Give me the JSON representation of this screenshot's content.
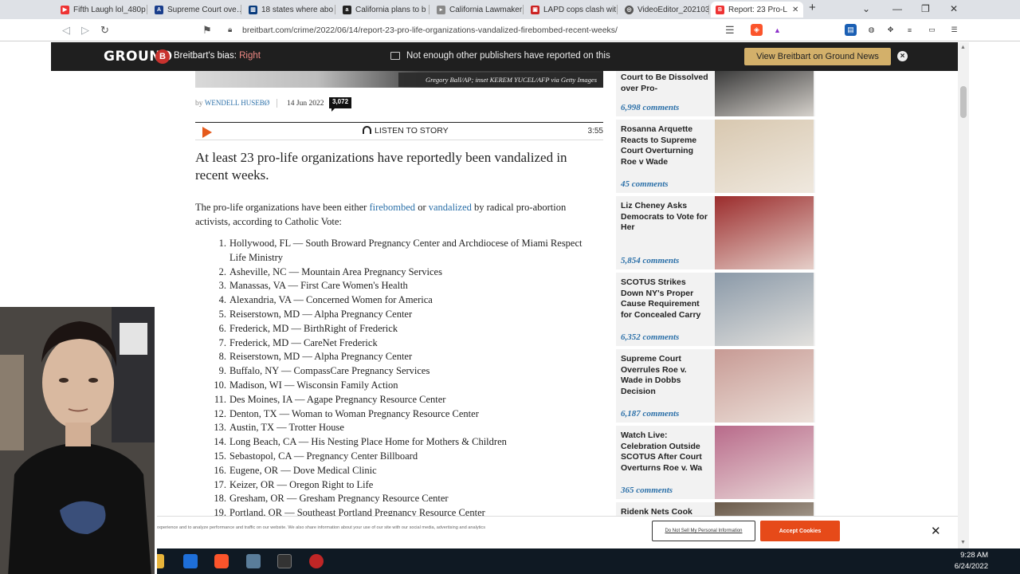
{
  "browser": {
    "tabs": [
      {
        "label": "Fifth Laugh lol_480p",
        "fav_color": "#e33"
      },
      {
        "label": "Supreme Court ove…",
        "fav_color": "#1a3e8c"
      },
      {
        "label": "18 states where abo",
        "fav_color": "#0a3c7d"
      },
      {
        "label": "California plans to b",
        "fav_color": "#222"
      },
      {
        "label": "California Lawmaker",
        "fav_color": "#888"
      },
      {
        "label": "LAPD cops clash wit",
        "fav_color": "#c22"
      },
      {
        "label": "VideoEditor_202103",
        "fav_color": "#555"
      },
      {
        "label": "Report: 23 Pro-L",
        "fav_color": "#e33"
      }
    ],
    "new_tab": "+",
    "url": "breitbart.com/crime/2022/06/14/report-23-pro-life-organizations-vandalized-firebombed-recent-weeks/"
  },
  "ground_news": {
    "logo": "GROUND",
    "bias_label": "Breitbart's bias:",
    "bias_value": "Right",
    "coverage_text": "Not enough other publishers have reported on this",
    "view_button": "View Breitbart on Ground News",
    "close": "×"
  },
  "article": {
    "photo_credit": "Gregory Ball/AP; inset KEREM YUCEL/AFP via Getty Images",
    "by": "by",
    "author": "WENDELL HUSEBØ",
    "date": "14 Jun 2022",
    "comment_count": "3,072",
    "listen_label": "LISTEN TO STORY",
    "duration": "3:55",
    "lead": "At least 23 pro-life organizations have reportedly been vandalized in recent weeks.",
    "intro_a": "The pro-life organizations have been either ",
    "intro_link1": "firebombed",
    "intro_b": " or ",
    "intro_link2": "vandalized",
    "intro_c": " by radical pro-abortion activists, according to Catholic Vote:",
    "list": [
      {
        "n": "1.",
        "text": "Hollywood, FL — South Broward Pregnancy Center and Archdiocese of Miami Respect Life Ministry"
      },
      {
        "n": "2.",
        "text": "Asheville, NC — Mountain Area Pregnancy Services"
      },
      {
        "n": "3.",
        "text": "Manassas, VA — First Care Women's Health"
      },
      {
        "n": "4.",
        "text": "Alexandria, VA — Concerned Women for America"
      },
      {
        "n": "5.",
        "text": "Reiserstown, MD — Alpha Pregnancy Center"
      },
      {
        "n": "6.",
        "text": "Frederick, MD — BirthRight of Frederick"
      },
      {
        "n": "7.",
        "text": "Frederick, MD — CareNet Frederick"
      },
      {
        "n": "8.",
        "text": "Reiserstown, MD — Alpha Pregnancy Center"
      },
      {
        "n": "9.",
        "text": "Buffalo, NY — CompassCare Pregnancy Services"
      },
      {
        "n": "10.",
        "text": "Madison, WI — Wisconsin Family Action"
      },
      {
        "n": "11.",
        "text": "Des Moines, IA — Agape Pregnancy Resource Center"
      },
      {
        "n": "12.",
        "text": "Denton, TX — Woman to Woman Pregnancy Resource Center"
      },
      {
        "n": "13.",
        "text": "Austin, TX — Trotter House"
      },
      {
        "n": "14.",
        "text": "Long Beach, CA — His Nesting Place Home for Mothers & Children"
      },
      {
        "n": "15.",
        "text": "Sebastopol, CA — Pregnancy Center Billboard"
      },
      {
        "n": "16.",
        "text": "Eugene, OR — Dove Medical Clinic"
      },
      {
        "n": "17.",
        "text": "Keizer, OR — Oregon Right to Life"
      },
      {
        "n": "18.",
        "text": "Gresham, OR — Gresham Pregnancy Resource Center"
      },
      {
        "n": "19.",
        "text": "Portland, OR — Southeast Portland Pregnancy Resource Center"
      }
    ]
  },
  "sidebar": [
    {
      "title": "Court to Be Dissolved over Pro-",
      "comments": "6,998 comments",
      "thumb": "#3b3b3b"
    },
    {
      "title": "Rosanna Arquette Reacts to Supreme Court Overturning Roe v Wade",
      "comments": "45 comments",
      "thumb": "#d8c8b0"
    },
    {
      "title": "Liz Cheney Asks Democrats to Vote for Her",
      "comments": "5,854 comments",
      "thumb": "#9b2c2c"
    },
    {
      "title": "SCOTUS Strikes Down NY's Proper Cause Requirement for Concealed Carry",
      "comments": "6,352 comments",
      "thumb": "#8a99a8"
    },
    {
      "title": "Supreme Court Overrules Roe v. Wade in Dobbs Decision",
      "comments": "6,187 comments",
      "thumb": "#c79a94"
    },
    {
      "title": "Watch Live: Celebration Outside SCOTUS After Court Overturns Roe v. Wa",
      "comments": "365 comments",
      "thumb": "#b86a8a"
    },
    {
      "title": "Ridenk Nets Cook",
      "comments": "",
      "thumb": "#6a5a4a"
    }
  ],
  "cookie": {
    "text": "experience and to analyze performance and traffic on our website. We also share information about your use of our site with our social media, advertising and analytics",
    "dns_button": "Do Not Sell My Personal Information",
    "accept_button": "Accept Cookies",
    "close": "✕"
  },
  "taskbar": {
    "time": "9:28 AM",
    "date": "6/24/2022"
  }
}
